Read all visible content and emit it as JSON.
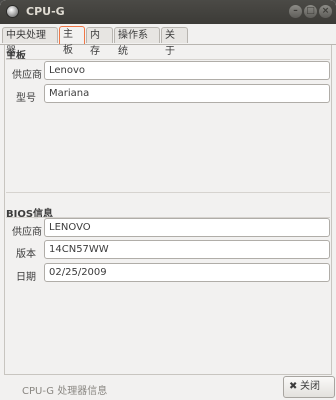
{
  "window": {
    "title": "CPU-G",
    "controls": {
      "minimize": "–",
      "maximize": "□",
      "close": "×"
    }
  },
  "tabs": [
    {
      "label": "中央处理器",
      "active": false
    },
    {
      "label": "主板",
      "active": true
    },
    {
      "label": "内存",
      "active": false
    },
    {
      "label": "操作系统",
      "active": false
    },
    {
      "label": "关于",
      "active": false
    }
  ],
  "motherboard": {
    "section_title": "主板",
    "vendor_label": "供应商",
    "vendor_value": "Lenovo",
    "model_label": "型号",
    "model_value": "Mariana"
  },
  "bios": {
    "section_title": "BIOS信息",
    "vendor_label": "供应商",
    "vendor_value": "LENOVO",
    "version_label": "版本",
    "version_value": "14CN57WW",
    "date_label": "日期",
    "date_value": "02/25/2009"
  },
  "status": {
    "text": "CPU-G 处理器信息"
  },
  "footer": {
    "close_icon": "✖",
    "close_label": "关闭(C)"
  },
  "colors": {
    "titlebar": "#3c3b37",
    "accent_tab": "#f07746",
    "window_bg": "#f2f1f0"
  }
}
